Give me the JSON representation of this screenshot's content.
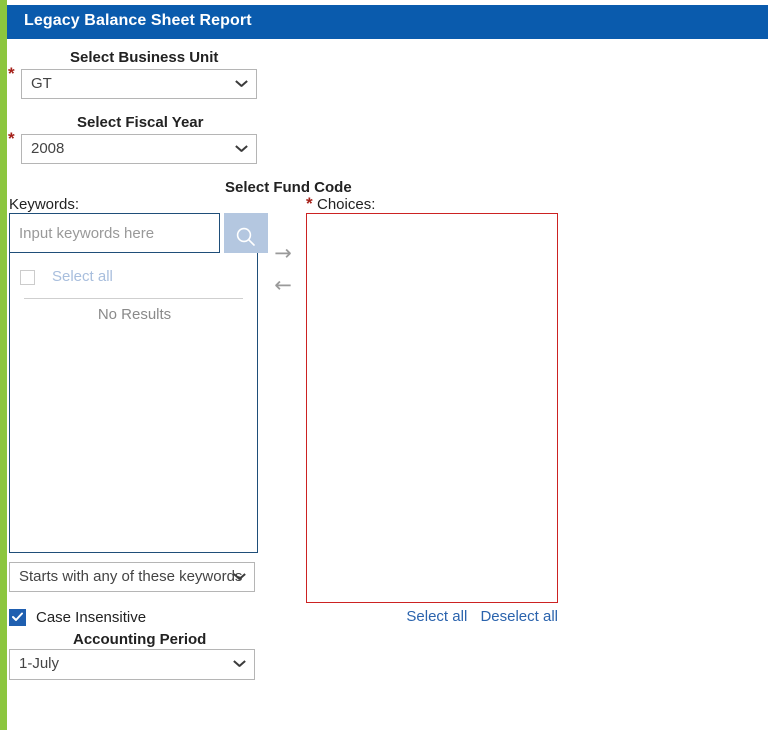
{
  "theme": {
    "header_blue": "#0a5bad",
    "accent_green": "#8cc63f",
    "required_red": "#a52019",
    "error_border_red": "#cc2222",
    "link_blue": "#2a63ad",
    "search_button_blue": "#b4c7e0",
    "checkbox_blue": "#1f5fb0"
  },
  "header": {
    "title": "Legacy Balance Sheet Report"
  },
  "business_unit": {
    "label": "Select Business Unit",
    "required_marker": "*",
    "value": "GT"
  },
  "fiscal_year": {
    "label": "Select Fiscal Year",
    "required_marker": "*",
    "value": "2008"
  },
  "fund_code": {
    "label": "Select Fund Code",
    "keywords": {
      "label": "Keywords:",
      "value": "",
      "placeholder": "Input keywords here",
      "search_icon": "search-icon"
    },
    "results": {
      "select_all_label": "Select all",
      "select_all_checked": false,
      "empty_text": "No Results"
    },
    "transfer": {
      "add_icon": "→",
      "remove_icon": "←"
    },
    "choices": {
      "label": "Choices:",
      "required_marker": "*",
      "items": [],
      "select_all_link": "Select all",
      "deselect_all_link": "Deselect all"
    },
    "match_mode": {
      "value": "Starts with any of these keywords"
    },
    "case_insensitive": {
      "label": "Case Insensitive",
      "checked": true,
      "check_icon": "checkmark-icon"
    }
  },
  "accounting_period": {
    "label": "Accounting Period",
    "value": "1-July"
  }
}
